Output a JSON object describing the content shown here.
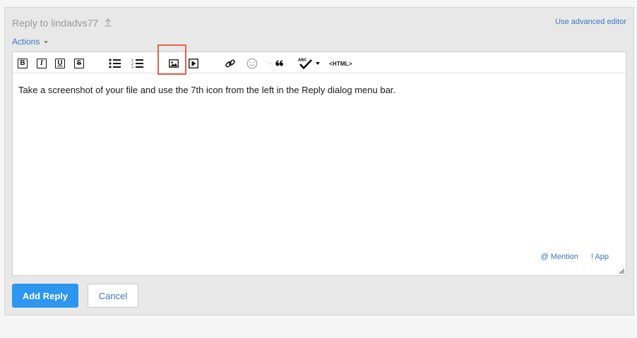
{
  "header": {
    "title": "Reply to lindadvs77",
    "advanced_link": "Use advanced editor",
    "actions_label": "Actions"
  },
  "toolbar": {
    "bold": "B",
    "italic": "I",
    "underline": "U",
    "strike": "S",
    "spell_label": "ABC",
    "html_label": "<HTML>",
    "highlight_color": "#e2644a"
  },
  "editor": {
    "content": "Take a screenshot of your file and use the 7th icon from the left in the Reply dialog menu bar.",
    "mention_label": "@ Mention",
    "app_label": "! App"
  },
  "buttons": {
    "add_reply": "Add Reply",
    "cancel": "Cancel"
  },
  "colors": {
    "accent": "#2d96f0",
    "link": "#3d74c6"
  }
}
